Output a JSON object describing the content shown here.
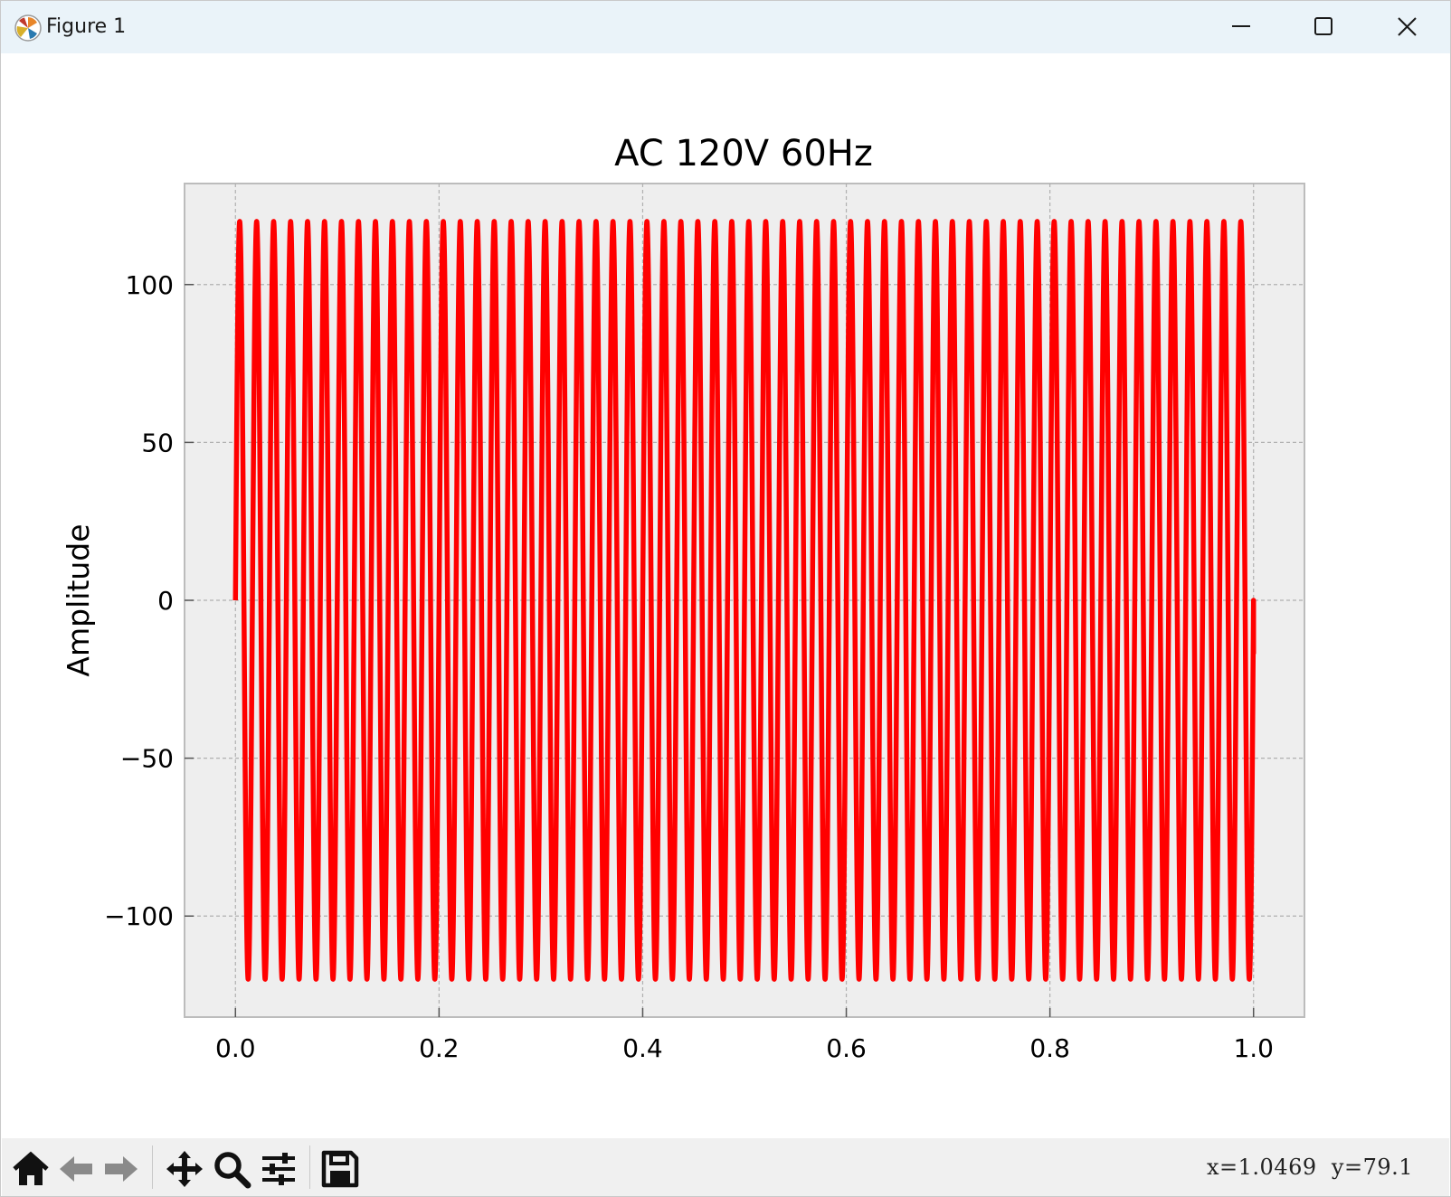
{
  "window": {
    "title": "Figure 1"
  },
  "toolbar": {
    "buttons": [
      {
        "icon": "home-icon"
      },
      {
        "icon": "back-arrow-icon"
      },
      {
        "icon": "forward-arrow-icon"
      },
      {
        "icon": "pan-icon"
      },
      {
        "icon": "zoom-icon"
      },
      {
        "icon": "configure-subplots-icon"
      },
      {
        "icon": "save-icon"
      }
    ],
    "coordinates": "x=1.0469  y=79.1"
  },
  "chart_data": {
    "type": "line",
    "title": "AC 120V 60Hz",
    "xlabel": "",
    "ylabel": "Amplitude",
    "xlim": [
      -0.05,
      1.05
    ],
    "ylim": [
      -132,
      132
    ],
    "xticks": [
      0.0,
      0.2,
      0.4,
      0.6,
      0.8,
      1.0
    ],
    "xtick_labels": [
      "0.0",
      "0.2",
      "0.4",
      "0.6",
      "0.8",
      "1.0"
    ],
    "yticks": [
      -100,
      -50,
      0,
      50,
      100
    ],
    "ytick_labels": [
      "−100",
      "−50",
      "0",
      "50",
      "100"
    ],
    "grid": true,
    "series": [
      {
        "function": "120*sin(2*pi*60*t)",
        "amplitude": 120,
        "frequency_hz": 60,
        "x_start": 0.0,
        "x_end": 1.0,
        "end_value": -17,
        "color": "#ff0000"
      }
    ],
    "axes_facecolor": "#eeeeee",
    "axes_edgecolor": "#bcbcbc"
  }
}
